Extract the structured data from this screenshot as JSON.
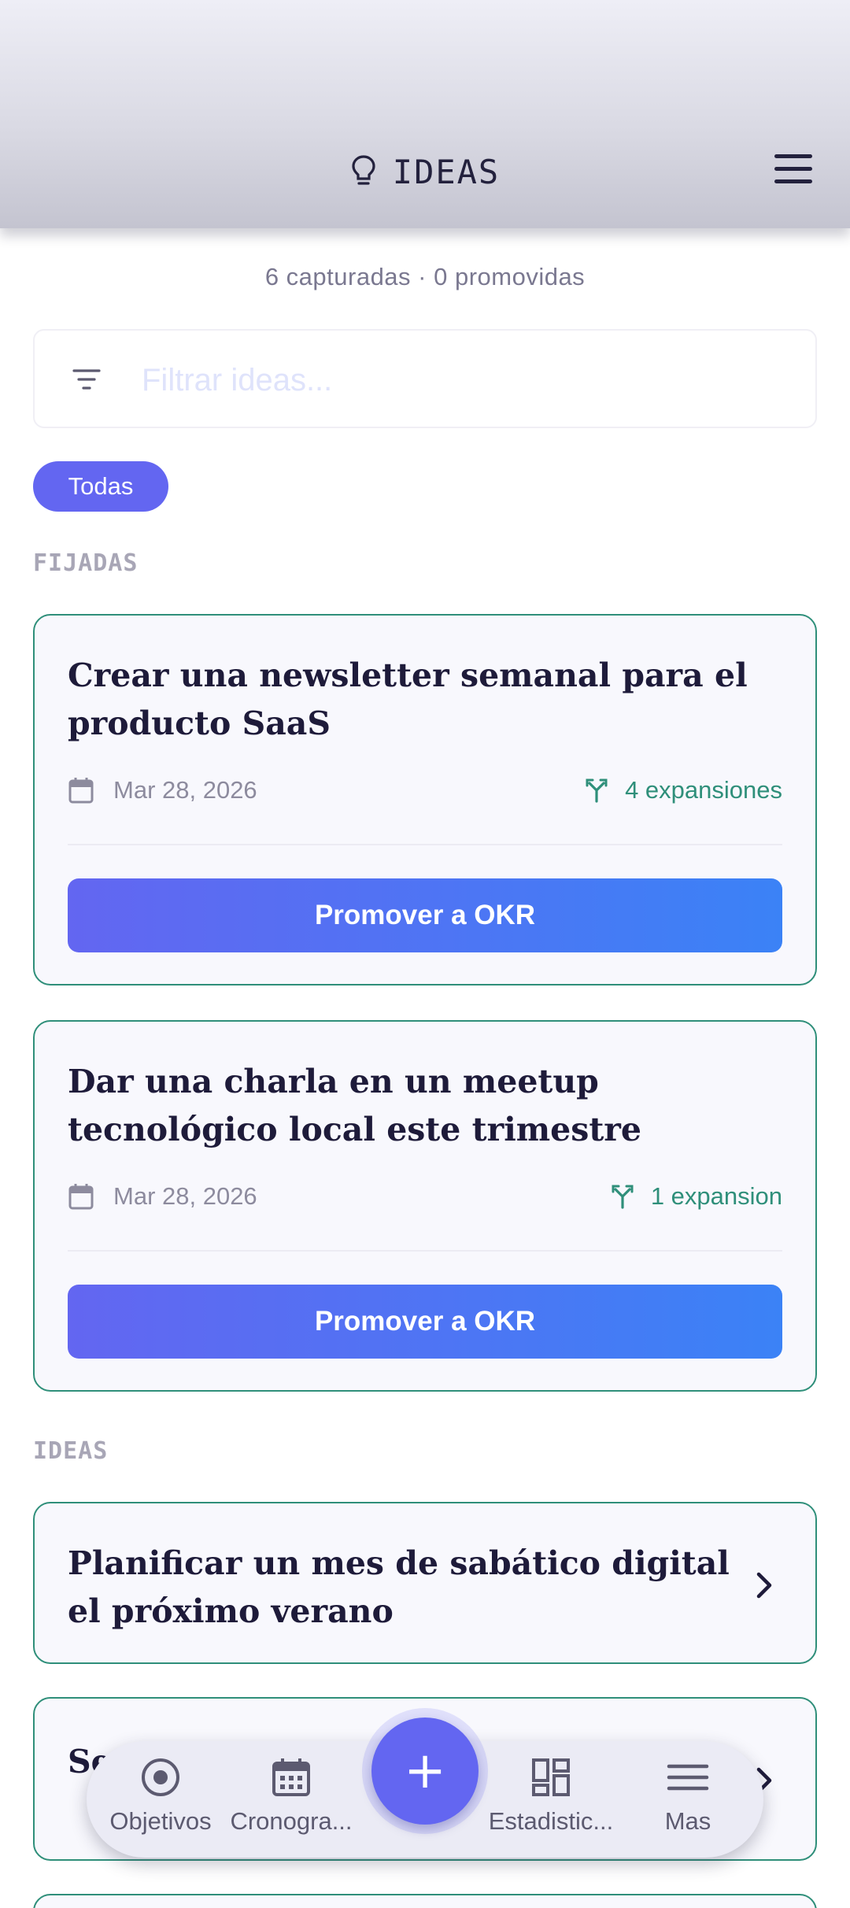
{
  "header": {
    "title": "IDEAS",
    "title_icon": "lightbulb-icon",
    "menu_icon": "hamburger-menu-icon"
  },
  "summary": "6 capturadas · 0 promovidas",
  "filter": {
    "icon": "filter-icon",
    "placeholder": "Filtrar ideas...",
    "value": ""
  },
  "chips": [
    {
      "label": "Todas",
      "selected": true
    }
  ],
  "sections": {
    "pinned_label": "FIJADAS",
    "ideas_label": "IDEAS"
  },
  "pinned_cards": [
    {
      "title": "Crear una newsletter semanal para el producto SaaS",
      "date": "Mar 28, 2026",
      "expansions": "4 expansiones",
      "button": "Promover a OKR"
    },
    {
      "title": "Dar una charla en un meetup tecnológico local este trimestre",
      "date": "Mar 28, 2026",
      "expansions": "1 expansion",
      "button": "Promover a OKR"
    }
  ],
  "idea_cards": [
    {
      "title": "Planificar un mes de sabático digital el próximo verano"
    },
    {
      "title": "Se r"
    }
  ],
  "bottom_nav": {
    "items": [
      {
        "label": "Objetivos",
        "icon": "target-icon"
      },
      {
        "label": "Cronogra...",
        "icon": "calendar-icon"
      },
      {
        "label": "Estadistic...",
        "icon": "dashboard-icon"
      },
      {
        "label": "Mas",
        "icon": "menu-icon"
      }
    ],
    "fab": {
      "label": "+",
      "icon": "plus-icon"
    }
  },
  "colors": {
    "accent": "#6366f1",
    "accent_end": "#3b82f6",
    "card_border": "#2f8f7a",
    "text_dark": "#1e1b3a",
    "text_muted": "#8d8b9e"
  }
}
